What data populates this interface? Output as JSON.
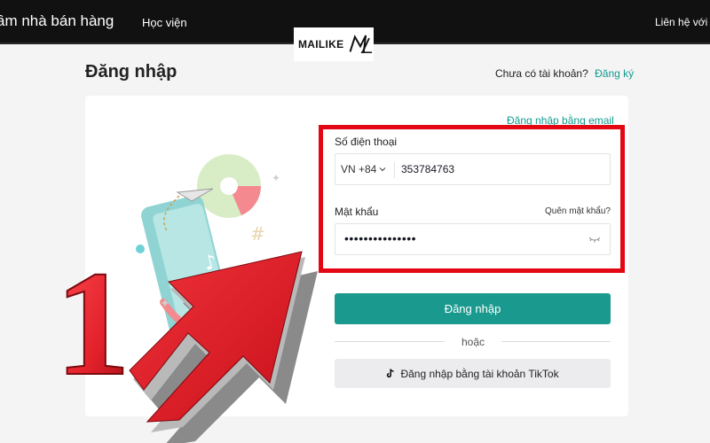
{
  "topbar": {
    "brand": "ầm nhà bán hàng",
    "nav_link": "Học viện",
    "contact": "Liên hệ với c"
  },
  "logo": {
    "text": "MAILIKE"
  },
  "page": {
    "title": "Đăng nhập",
    "no_account_text": "Chưa có tài khoản?",
    "signup_link": "Đăng ký"
  },
  "form": {
    "email_login_link": "Đăng nhập bằng email",
    "phone_label": "Số điện thoại",
    "country_code": "VN +84",
    "phone_value": "353784763",
    "password_label": "Mật khẩu",
    "forgot_password": "Quên mật khẩu?",
    "password_value": "•••••••••••••••",
    "login_button": "Đăng nhập",
    "or_text": "hoặc",
    "tiktok_button": "Đăng nhập bằng tài khoản TikTok"
  },
  "annotation": {
    "step_number": "1"
  },
  "colors": {
    "accent": "#1a9a8e",
    "link": "#0f9b8e",
    "highlight": "#e30613",
    "arrow": "#e3212b",
    "topbar": "#111111"
  },
  "icons": [
    "chevron-down-icon",
    "eye-closed-icon",
    "tiktok-icon",
    "arrow-annotation"
  ]
}
